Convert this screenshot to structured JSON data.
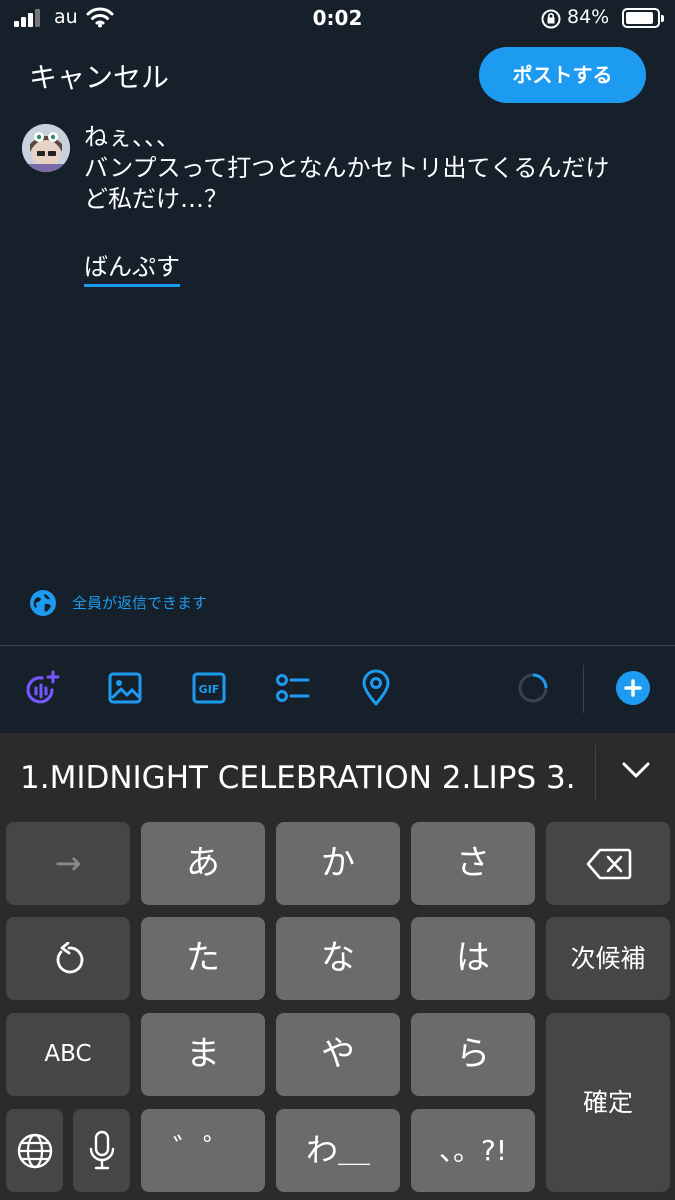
{
  "status_bar": {
    "carrier": "au",
    "time": "0:02",
    "battery_percent": "84%",
    "battery_level": 0.84
  },
  "header": {
    "cancel_label": "キャンセル",
    "post_label": "ポストする"
  },
  "compose": {
    "lines": [
      "ねぇ、、、",
      "バンプスって打つとなんかセトリ出てくるんだけ",
      "ど私だけ…？"
    ],
    "composing_text": "ばんぷす"
  },
  "reply_setting": {
    "label": "全員が返信できます",
    "icon": "globe-icon"
  },
  "toolbar": {
    "icons": [
      "spaces-icon",
      "image-icon",
      "gif-icon",
      "poll-icon",
      "location-icon",
      "progress-ring",
      "add-icon"
    ],
    "gif_label": "GIF"
  },
  "keyboard": {
    "candidate": "1.MIDNIGHT CELEBRATION 2.LIPS 3.",
    "keys": {
      "arrow": "→",
      "a": "あ",
      "ka": "か",
      "sa": "さ",
      "ta": "た",
      "na": "な",
      "ha": "は",
      "next_candidate": "次候補",
      "abc": "ABC",
      "ma": "ま",
      "ya": "や",
      "ra": "ら",
      "confirm": "確定",
      "dakuten": "゛゜",
      "wa": "わ＿",
      "punct": "、。?!"
    }
  },
  "colors": {
    "background": "#15202b",
    "accent": "#1d9bf0",
    "spaces_purple": "#7856ff",
    "key": "#6b6b6e",
    "key_dark": "#464649"
  }
}
